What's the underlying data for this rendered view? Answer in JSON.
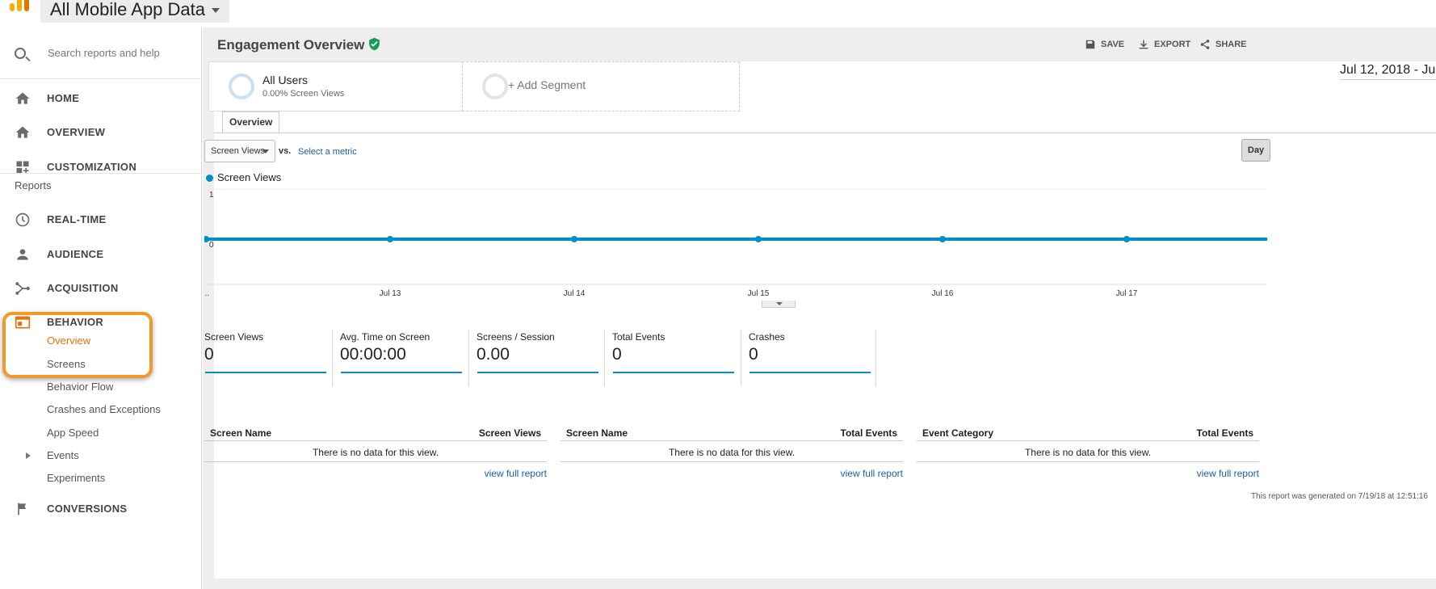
{
  "header": {
    "account_label": "All Mobile App Data"
  },
  "sidebar": {
    "search_placeholder": "Search reports and help",
    "home": "HOME",
    "overview": "OVERVIEW",
    "customization": "CUSTOMIZATION",
    "reports_label": "Reports",
    "realtime": "REAL-TIME",
    "audience": "AUDIENCE",
    "acquisition": "ACQUISITION",
    "behavior": "BEHAVIOR",
    "behavior_items": [
      "Overview",
      "Screens",
      "Behavior Flow",
      "Crashes and Exceptions",
      "App Speed",
      "Events",
      "Experiments"
    ],
    "conversions": "CONVERSIONS"
  },
  "page": {
    "title": "Engagement Overview",
    "toolbar": {
      "save": "SAVE",
      "export": "EXPORT",
      "share": "SHARE"
    },
    "segments": {
      "all_users_title": "All Users",
      "all_users_sub": "0.00% Screen Views",
      "add_segment": "+ Add Segment"
    },
    "date_range": "Jul 12, 2018 - Ju",
    "tab": "Overview",
    "metric_select": "Screen Views",
    "vs_label": "vs.",
    "select_metric": "Select a metric",
    "day_button": "Day",
    "scorecards": [
      {
        "label": "Screen Views",
        "value": "0"
      },
      {
        "label": "Avg. Time on Screen",
        "value": "00:00:00"
      },
      {
        "label": "Screens / Session",
        "value": "0.00"
      },
      {
        "label": "Total Events",
        "value": "0"
      },
      {
        "label": "Crashes",
        "value": "0"
      }
    ],
    "tables": [
      {
        "col1": "Screen Name",
        "col2": "Screen Views",
        "empty": "There is no data for this view.",
        "link": "view full report"
      },
      {
        "col1": "Screen Name",
        "col2": "Total Events",
        "empty": "There is no data for this view.",
        "link": "view full report"
      },
      {
        "col1": "Event Category",
        "col2": "Total Events",
        "empty": "There is no data for this view.",
        "link": "view full report"
      }
    ],
    "generated": "This report was generated on 7/19/18 at 12:51:16"
  },
  "colors": {
    "series": "#058dc7",
    "highlight": "#f09a2a",
    "active": "#e8710a",
    "verified": "#0f9d58"
  },
  "chart_data": {
    "type": "line",
    "legend": "Screen Views",
    "x": [
      "...",
      "Jul 13",
      "Jul 14",
      "Jul 15",
      "Jul 16",
      "Jul 17"
    ],
    "series": [
      {
        "name": "Screen Views",
        "values": [
          0,
          0,
          0,
          0,
          0,
          0
        ]
      }
    ],
    "yticks": [
      "1",
      "0"
    ],
    "ylim": [
      0,
      1
    ]
  }
}
